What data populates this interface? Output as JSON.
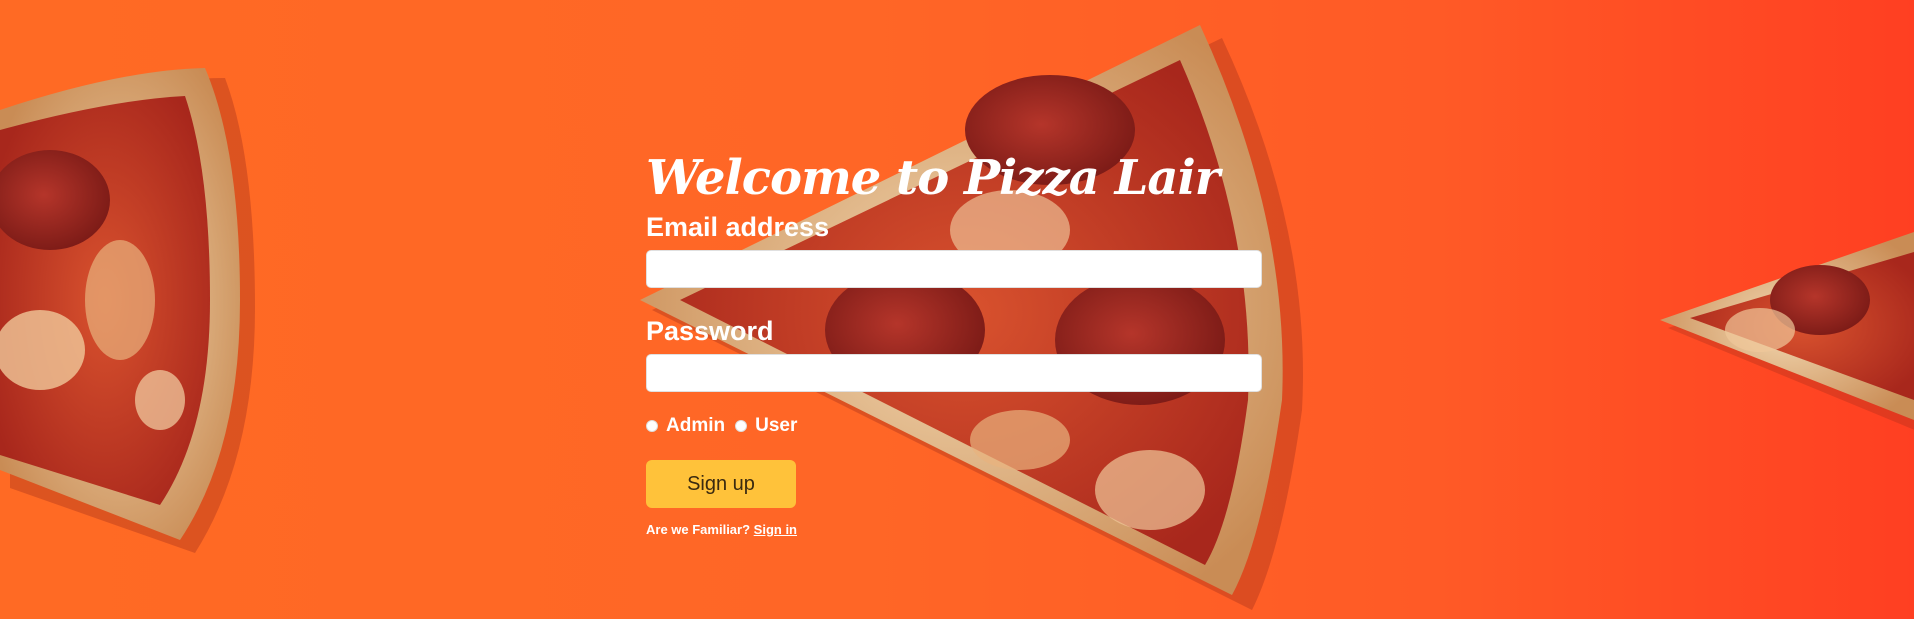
{
  "page": {
    "title": "Welcome to Pizza Lair",
    "background_color": "#ff6626",
    "background_image": "pizza-slices-photo"
  },
  "form": {
    "email_label": "Email address",
    "email_value": "",
    "password_label": "Password",
    "password_value": "",
    "roles": [
      {
        "label": "Admin",
        "selected": false
      },
      {
        "label": "User",
        "selected": false
      }
    ],
    "submit_label": "Sign up",
    "submit_color": "#ffc23a",
    "footer_text": "Are we Familiar?",
    "footer_link": "Sign in"
  }
}
